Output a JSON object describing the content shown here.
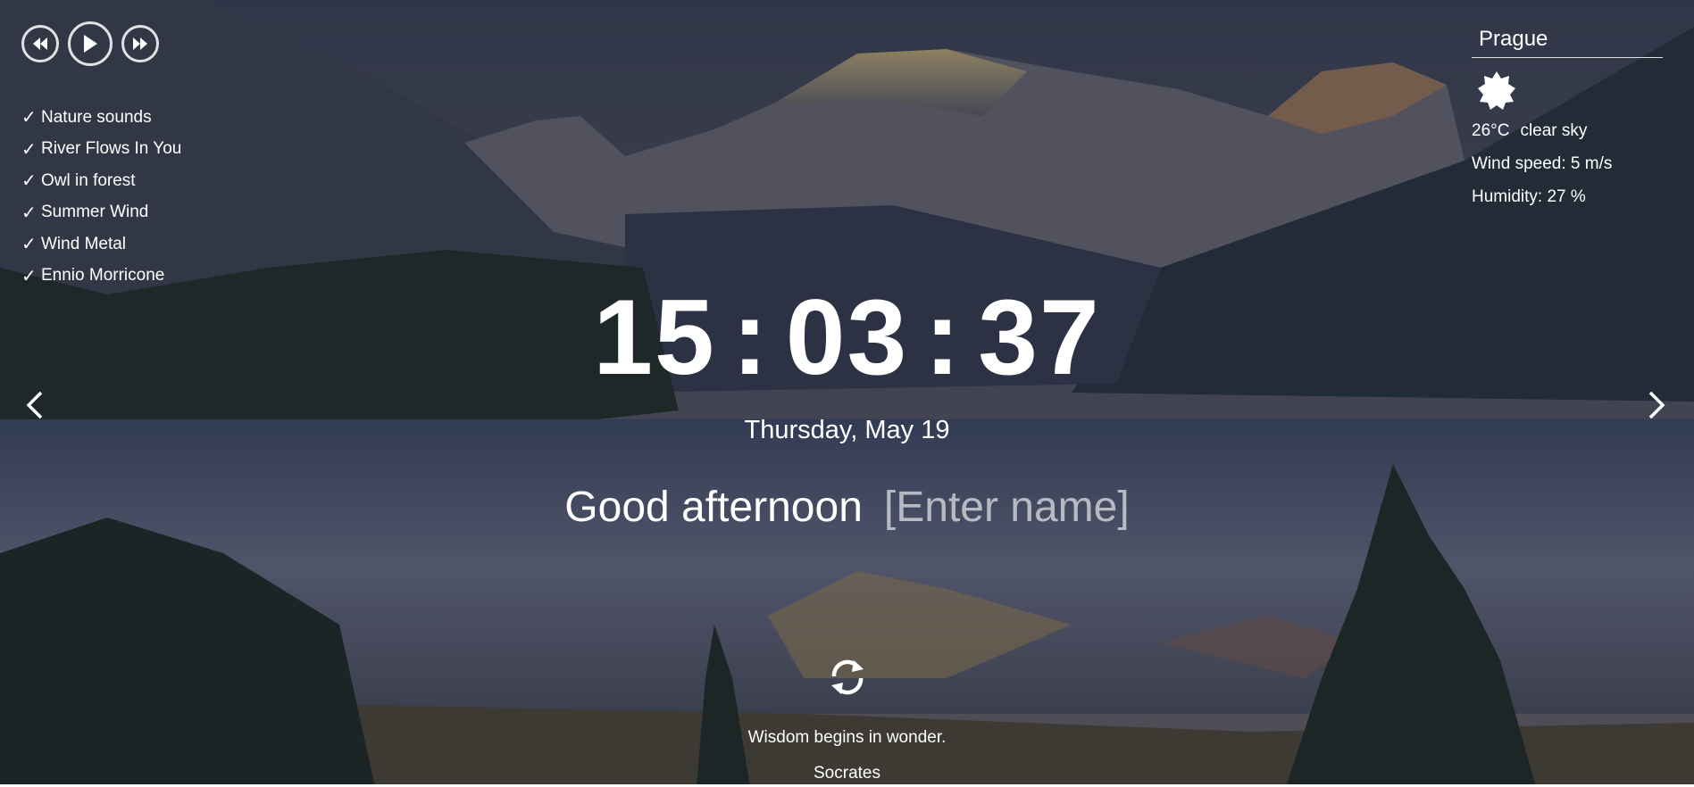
{
  "player": {
    "buttons": [
      "prev-icon",
      "play-icon",
      "next-icon"
    ],
    "playlist": [
      {
        "label": "Nature sounds"
      },
      {
        "label": "River Flows In You"
      },
      {
        "label": "Owl in forest"
      },
      {
        "label": "Summer Wind"
      },
      {
        "label": "Wind Metal"
      },
      {
        "label": "Ennio Morricone"
      }
    ],
    "check_glyph": "✓"
  },
  "weather": {
    "city": "Prague",
    "icon": "sun-icon",
    "temperature": "26°C",
    "description": "clear sky",
    "wind": "Wind speed: 5 m/s",
    "humidity": "Humidity: 27 %"
  },
  "clock": {
    "hours": "15",
    "minutes": "03",
    "seconds": "37",
    "separator": ":"
  },
  "date": "Thursday, May 19",
  "greeting": {
    "text": "Good afternoon",
    "name_placeholder": "[Enter name]"
  },
  "quote": {
    "text": "Wisdom begins in wonder.",
    "author": "Socrates"
  },
  "colors": {
    "text": "#ffffff",
    "placeholder": "#c9c9c9",
    "overlay": "#1f2535"
  }
}
